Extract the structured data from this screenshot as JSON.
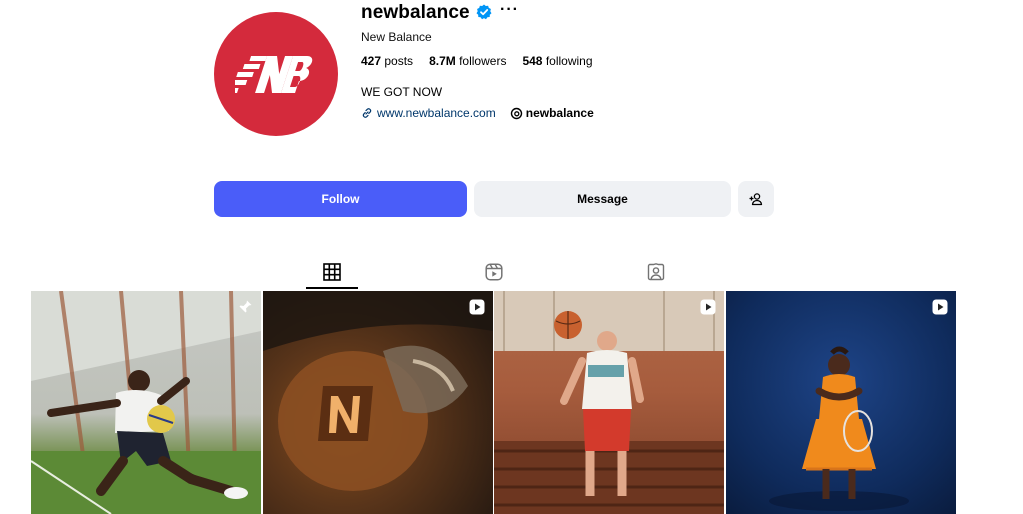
{
  "profile": {
    "username": "newbalance",
    "more_glyph": "···",
    "full_name": "New Balance",
    "stats": {
      "posts_value": "427",
      "posts_label": "posts",
      "followers_value": "8.7M",
      "followers_label": "followers",
      "following_value": "548",
      "following_label": "following"
    },
    "bio": "WE GOT NOW",
    "website": "www.newbalance.com",
    "threads_handle": "newbalance",
    "avatar_color": "#d42a3c"
  },
  "actions": {
    "follow_label": "Follow",
    "message_label": "Message",
    "follow_color": "#4a5df9"
  },
  "tabs": [
    {
      "name": "posts",
      "icon": "grid-icon",
      "active": true
    },
    {
      "name": "reels",
      "icon": "reels-icon",
      "active": false
    },
    {
      "name": "tagged",
      "icon": "tagged-icon",
      "active": false
    }
  ],
  "posts": [
    {
      "badge": "pin-icon"
    },
    {
      "badge": "reel-play-icon"
    },
    {
      "badge": "reel-play-icon"
    },
    {
      "badge": "reel-play-icon"
    }
  ]
}
